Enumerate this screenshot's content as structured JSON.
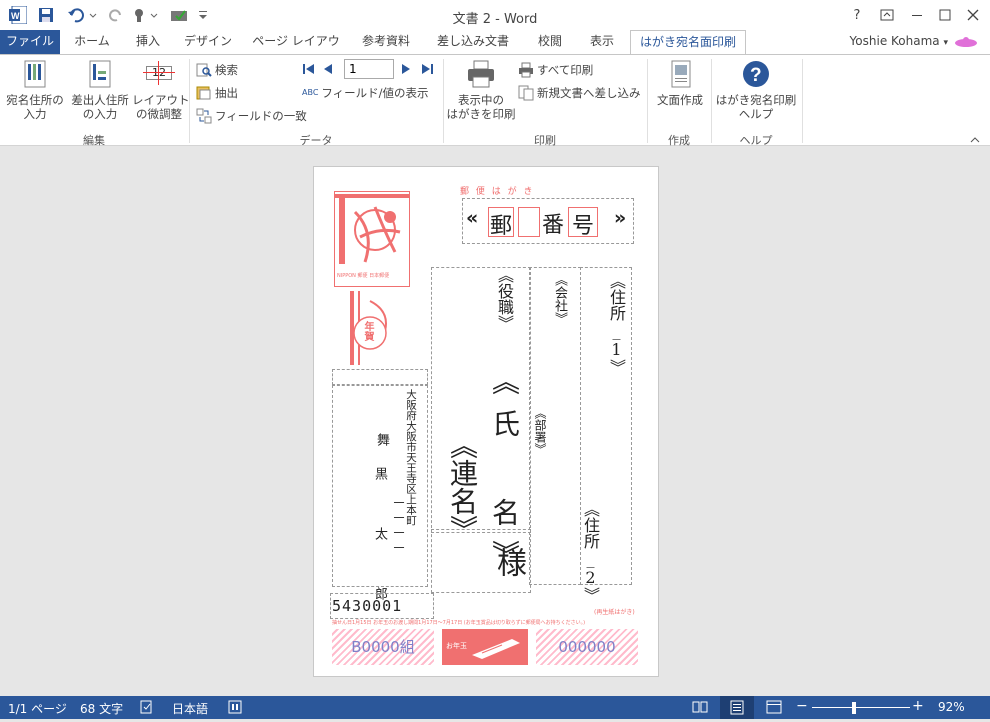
{
  "window": {
    "title": "文書 2 - Word",
    "user": "Yoshie Kohama",
    "help": "?"
  },
  "tabs": [
    "ファイル",
    "ホーム",
    "挿入",
    "デザイン",
    "ページ レイアウト",
    "参考資料",
    "差し込み文書",
    "校閲",
    "表示",
    "はがき宛名面印刷"
  ],
  "ribbon": {
    "edit": {
      "label": "編集",
      "btn1": "宛名住所の\n入力",
      "btn2": "差出人住所\nの入力",
      "btn3": "レイアウト\nの微調整",
      "btn3_nums": "12"
    },
    "data": {
      "label": "データ",
      "search": "検索",
      "extract": "抽出",
      "field_match": "フィールドの一致",
      "record": "1",
      "abc": "ABC",
      "field_value": "フィールド/値の表示"
    },
    "print": {
      "label": "印刷",
      "btn1": "表示中の\nはがきを印刷",
      "print_all": "すべて印刷",
      "merge_new": "新規文書へ差し込み"
    },
    "create": {
      "label": "作成",
      "btn1": "文面作成"
    },
    "help": {
      "label": "ヘルプ",
      "btn1": "はがき宛名印刷\nヘルプ"
    }
  },
  "postcard": {
    "header": "郵 便 は が き",
    "zip_field": "«郵便番号»",
    "zip_chars": [
      "«",
      "郵",
      "便",
      "番",
      "号",
      "»"
    ],
    "title_field": "《役職》",
    "company_field": "《会社》",
    "address1_field": "《住所_1》",
    "dept_field": "《部署》",
    "name_field": "《氏 名》",
    "joint_field": "《連名》",
    "address2_field": "《住所_2》",
    "sama": "様",
    "sender_address": "大阪府大阪市天王寺区上本町",
    "sender_number": "一一一一",
    "sender_name1": "舞",
    "sender_name2": "黒 太 郎",
    "sender_zip": "5430001",
    "nippon": "NIPPON 郵便 日本郵便",
    "nenga": "年賀",
    "lottery_group": "B0000組",
    "lottery_number": "000000",
    "recycled": "(再生紙はがき)",
    "notice": "抽せん日1月15日  お年玉のお渡し期間1月17日〜7月17日  (お年玉賞品は切り取らずに郵便局へお持ちください。)",
    "otoshidama": "お年玉"
  },
  "status": {
    "page": "1/1 ページ",
    "words": "68 文字",
    "lang": "日本語",
    "zoom": "92%",
    "zoom_minus": "−",
    "zoom_plus": "+"
  },
  "colors": {
    "accent": "#2b579a",
    "stamp": "#f07070",
    "lottery": "#8080c8"
  }
}
